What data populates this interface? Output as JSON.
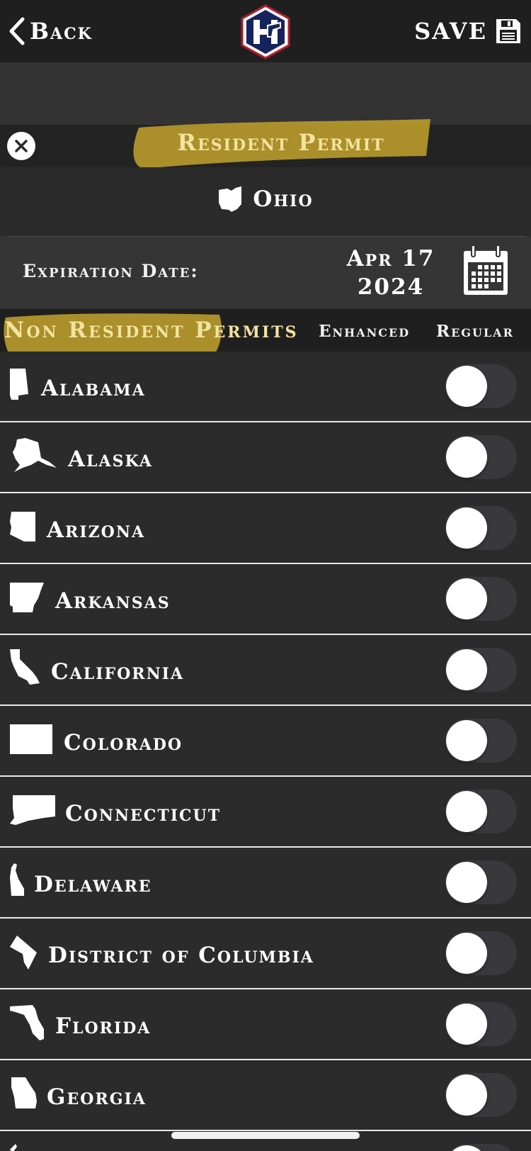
{
  "nav": {
    "back_label": "Back",
    "save_label": "SAVE"
  },
  "resident": {
    "title": "Resident Permit",
    "state": "Ohio",
    "expiration_label": "Expiration Date:",
    "expiration_date_line1": "Apr 17",
    "expiration_date_line2": "2024"
  },
  "nonresident": {
    "title": "Non Resident Permits",
    "col_enhanced": "Enhanced",
    "col_regular": "Regular"
  },
  "states": [
    {
      "name": "Alabama",
      "enabled": false
    },
    {
      "name": "Alaska",
      "enabled": false
    },
    {
      "name": "Arizona",
      "enabled": false
    },
    {
      "name": "Arkansas",
      "enabled": false
    },
    {
      "name": "California",
      "enabled": false
    },
    {
      "name": "Colorado",
      "enabled": false
    },
    {
      "name": "Connecticut",
      "enabled": false
    },
    {
      "name": "Delaware",
      "enabled": false
    },
    {
      "name": "District of Columbia",
      "enabled": false
    },
    {
      "name": "Florida",
      "enabled": false
    },
    {
      "name": "Georgia",
      "enabled": false
    }
  ],
  "colors": {
    "highlight": "#b99b2c",
    "gold_text": "#f3e3a0",
    "background": "#2b2b2c",
    "logo_navy": "#17245c",
    "logo_red": "#b11d2a"
  }
}
